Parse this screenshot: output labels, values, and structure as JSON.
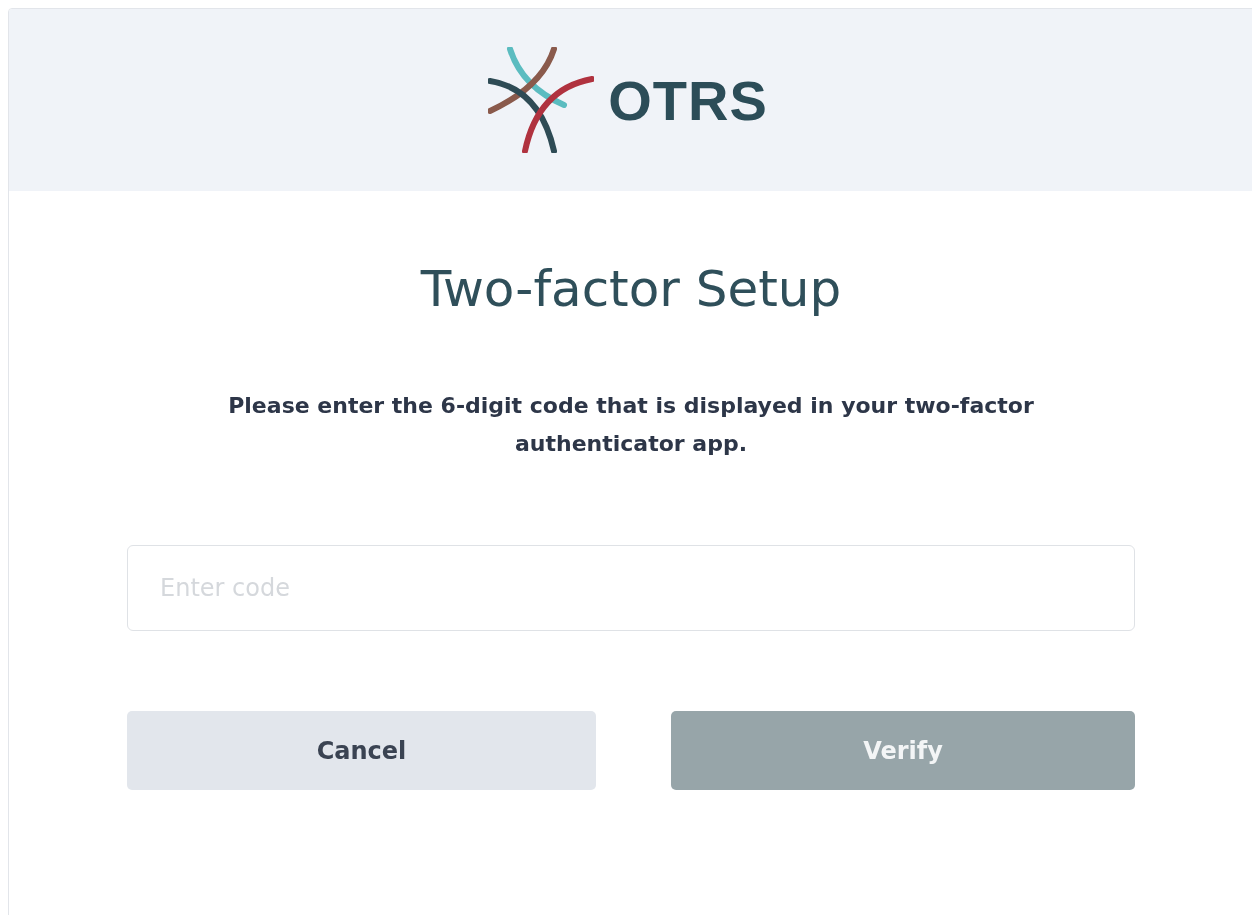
{
  "header": {
    "logo_text": "OTRS"
  },
  "title": "Two-factor Setup",
  "instructions": "Please enter the 6-digit code that is displayed in your two-factor authenticator app.",
  "code_field": {
    "placeholder": "Enter code"
  },
  "buttons": [
    {
      "label": "Cancel",
      "kind": "secondary",
      "disabled": false
    },
    {
      "label": "Verify",
      "kind": "primary",
      "disabled": true
    }
  ]
}
